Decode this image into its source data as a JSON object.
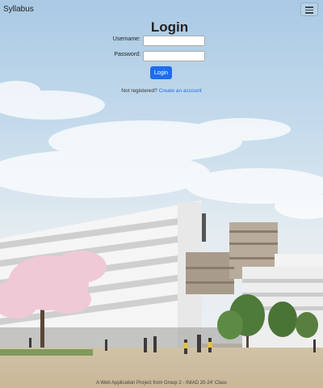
{
  "navbar": {
    "brand": "Syllabus",
    "menu_icon": "hamburger-menu-icon"
  },
  "login": {
    "title": "Login",
    "username_label": "Username:",
    "username_value": "",
    "password_label": "Password:",
    "password_value": "",
    "submit_label": "Login",
    "register_prompt": "Not registered?",
    "register_link": "Create an account"
  },
  "footer": {
    "text": "A Web Application Project from Group 2 - INIAD 20-24' Class"
  },
  "colors": {
    "accent": "#1e6cf0",
    "sky": "#bcd6ea",
    "ground": "#d8c8ad"
  }
}
